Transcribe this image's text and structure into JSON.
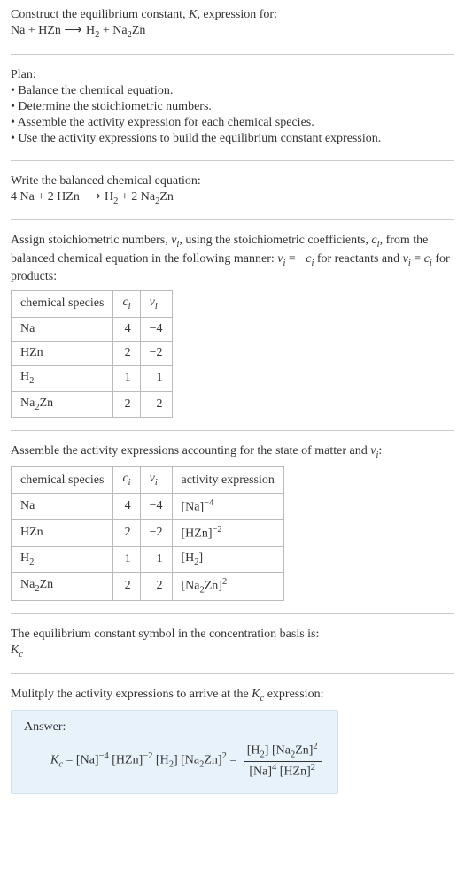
{
  "intro": {
    "line1_a": "Construct the equilibrium constant, ",
    "line1_K": "K",
    "line1_b": ", expression for:",
    "eq_lhs1": "Na + HZn",
    "arrow": "⟶",
    "eq_rhs_h2": "H",
    "eq_rhs_h2_sub": "2",
    "eq_rhs_plus": " + Na",
    "eq_rhs_na2_sub": "2",
    "eq_rhs_zn": "Zn"
  },
  "plan": {
    "heading": "Plan:",
    "b1": "• Balance the chemical equation.",
    "b2": "• Determine the stoichiometric numbers.",
    "b3": "• Assemble the activity expression for each chemical species.",
    "b4": "• Use the activity expressions to build the equilibrium constant expression."
  },
  "balanced": {
    "heading": "Write the balanced chemical equation:",
    "lhs": "4 Na + 2 HZn",
    "arrow": "⟶",
    "rhs_h": "H",
    "rhs_h2sub": "2",
    "rhs_plus": " + 2 Na",
    "rhs_na2sub": "2",
    "rhs_zn": "Zn"
  },
  "assign": {
    "text_a": "Assign stoichiometric numbers, ",
    "nu": "ν",
    "sub_i": "i",
    "text_b": ", using the stoichiometric coefficients, ",
    "c": "c",
    "text_c": ", from the balanced chemical equation in the following manner: ",
    "rel1": " = −",
    "text_d": " for reactants and ",
    "rel2": " = ",
    "text_e": " for products:"
  },
  "table1": {
    "h1": "chemical species",
    "h2_c": "c",
    "h2_i": "i",
    "h3_nu": "ν",
    "h3_i": "i",
    "rows": [
      {
        "species": "Na",
        "sub": "",
        "c": "4",
        "nu": "−4"
      },
      {
        "species": "HZn",
        "sub": "",
        "c": "2",
        "nu": "−2"
      },
      {
        "species": "H",
        "sub": "2",
        "c": "1",
        "nu": "1"
      },
      {
        "species": "Na",
        "sub": "2",
        "tail": "Zn",
        "c": "2",
        "nu": "2"
      }
    ]
  },
  "assemble": {
    "text_a": "Assemble the activity expressions accounting for the state of matter and ",
    "nu": "ν",
    "sub_i": "i",
    "text_b": ":"
  },
  "table2": {
    "h1": "chemical species",
    "h2_c": "c",
    "h2_i": "i",
    "h3_nu": "ν",
    "h3_i": "i",
    "h4": "activity expression",
    "rows": [
      {
        "sp": "Na",
        "sub": "",
        "c": "4",
        "nu": "−4",
        "act_in": "[Na]",
        "act_sup": "−4"
      },
      {
        "sp": "HZn",
        "sub": "",
        "c": "2",
        "nu": "−2",
        "act_in": "[HZn]",
        "act_sup": "−2"
      },
      {
        "sp": "H",
        "sub": "2",
        "c": "1",
        "nu": "1",
        "act_pre": "[H",
        "act_sub": "2",
        "act_post": "]",
        "act_sup": ""
      },
      {
        "sp": "Na",
        "sub": "2",
        "tail": "Zn",
        "c": "2",
        "nu": "2",
        "act_pre": "[Na",
        "act_sub": "2",
        "act_post": "Zn]",
        "act_sup": "2"
      }
    ]
  },
  "symbol": {
    "line": "The equilibrium constant symbol in the concentration basis is:",
    "K": "K",
    "sub_c": "c"
  },
  "mult": {
    "text_a": "Mulitply the activity expressions to arrive at the ",
    "K": "K",
    "sub_c": "c",
    "text_b": " expression:"
  },
  "answer": {
    "label": "Answer:",
    "K": "K",
    "sub_c": "c",
    "eq": " = ",
    "t1": "[Na]",
    "t1_sup": "−4",
    "t2": " [HZn]",
    "t2_sup": "−2",
    "t3_pre": " [H",
    "t3_sub": "2",
    "t3_post": "]",
    "t4_pre": " [Na",
    "t4_sub": "2",
    "t4_post": "Zn]",
    "t4_sup": "2",
    "eq2": " = ",
    "num_a_pre": "[H",
    "num_a_sub": "2",
    "num_a_post": "]",
    "num_b_pre": " [Na",
    "num_b_sub": "2",
    "num_b_post": "Zn]",
    "num_b_sup": "2",
    "den_a": "[Na]",
    "den_a_sup": "4",
    "den_b": " [HZn]",
    "den_b_sup": "2"
  }
}
